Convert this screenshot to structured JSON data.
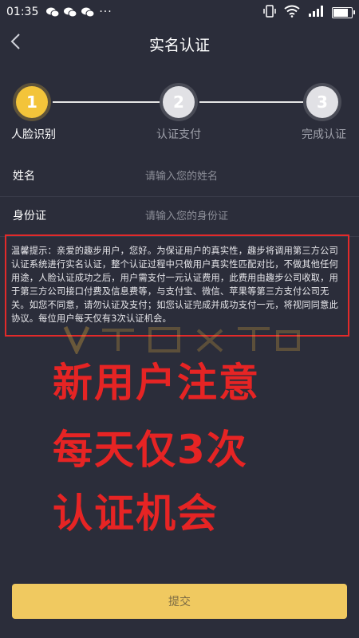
{
  "status_bar": {
    "time": "01:35",
    "icons_left": [
      "wechat-icon",
      "wechat-icon",
      "wechat-icon",
      "more-dots-icon"
    ],
    "icons_right": [
      "vibrate-icon",
      "wifi-icon",
      "signal-icon",
      "battery-icon"
    ]
  },
  "nav": {
    "title": "实名认证",
    "back_icon": "chevron-left-icon"
  },
  "steps": [
    {
      "number": "1",
      "label": "人脸识别",
      "active": true
    },
    {
      "number": "2",
      "label": "认证支付",
      "active": false
    },
    {
      "number": "3",
      "label": "完成认证",
      "active": false
    }
  ],
  "form": {
    "name_label": "姓名",
    "name_placeholder": "请输入您的姓名",
    "id_label": "身份证",
    "id_placeholder": "请输入您的身份证"
  },
  "notice": {
    "text": "温馨提示：亲爱的趣步用户，您好。为保证用户的真实性，趣步将调用第三方公司认证系统进行实名认证，整个认证过程中只做用户真实性匹配对比，不做其他任何用途，人脸认证成功之后，用户需支付一元认证费用，此费用由趣步公司收取，用于第三方公司接口付费及信息费等，与支付宝、微信、苹果等第三方支付公司无关。如您不同意，请勿认证及支付；如您认证完成并成功支付一元，将视同同意此协议。每位用户每天仅有3次认证机会。"
  },
  "overlay": {
    "line1": "新用户注意",
    "line2": "每天仅3次",
    "line3": "认证机会"
  },
  "submit_label": "提交",
  "colors": {
    "background": "#2b2d3a",
    "accent": "#f3c43a",
    "alert_red": "#e62424",
    "submit": "#f0c960"
  }
}
